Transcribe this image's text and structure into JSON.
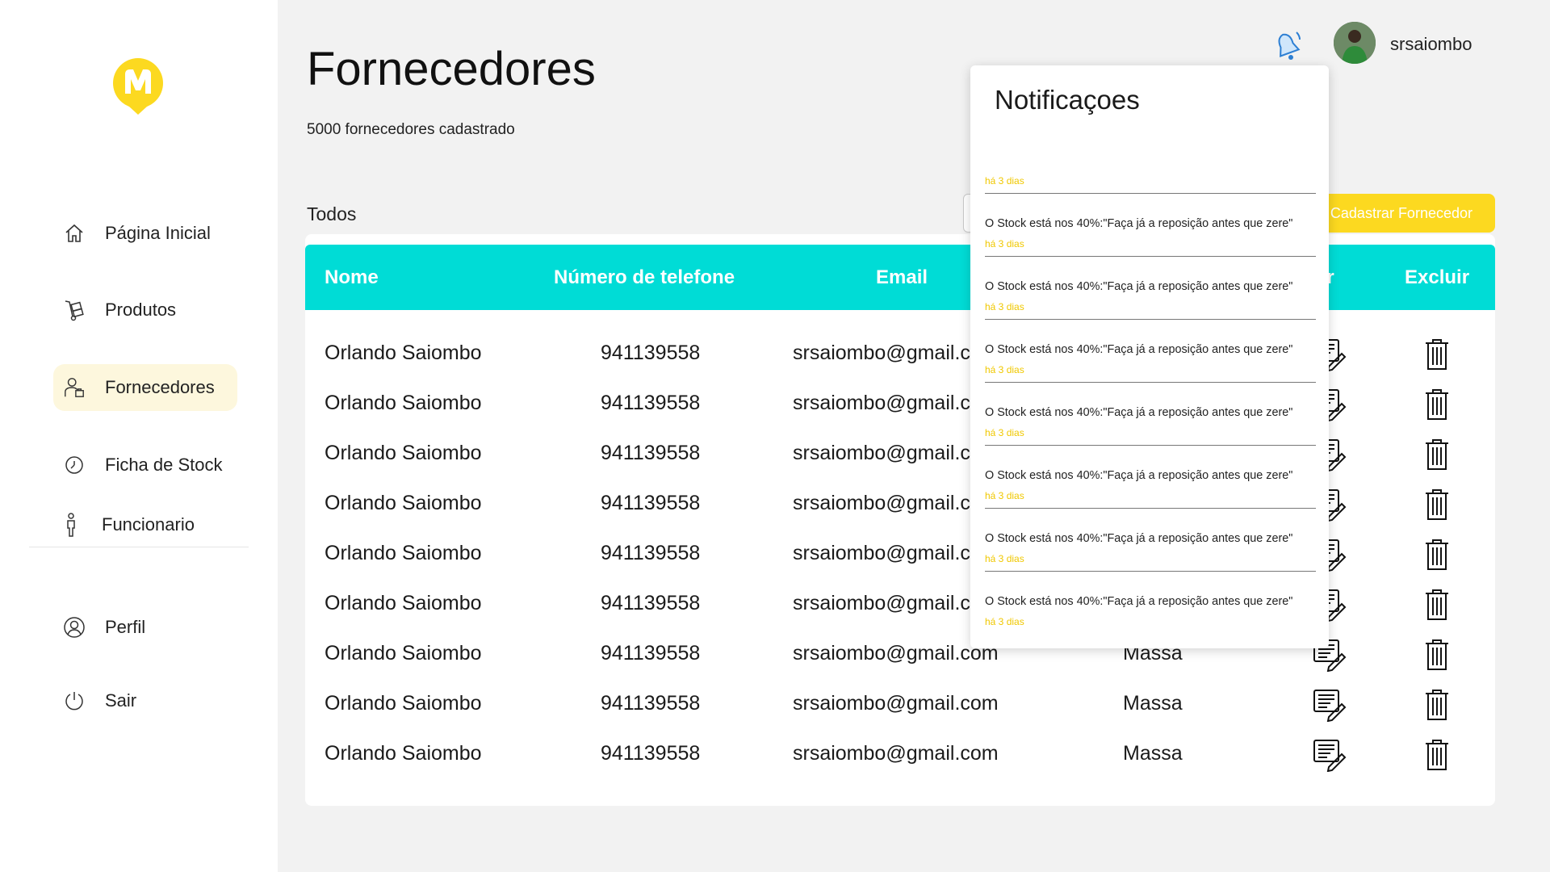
{
  "sidebar": {
    "items": [
      {
        "label": "Página Inicial",
        "icon": "home-icon"
      },
      {
        "label": "Produtos",
        "icon": "hand-truck-icon"
      },
      {
        "label": "Fornecedores",
        "icon": "supplier-icon",
        "active": true
      },
      {
        "label": "Ficha de Stock",
        "icon": "clock-icon"
      },
      {
        "label": "Funcionario",
        "icon": "person-icon"
      }
    ],
    "bottom_items": [
      {
        "label": "Perfil",
        "icon": "user-circle-icon"
      },
      {
        "label": "Sair",
        "icon": "power-icon"
      }
    ]
  },
  "header": {
    "title": "Fornecedores",
    "subtitle": "5000 fornecedores cadastrado",
    "username": "srsaiombo"
  },
  "toolbar": {
    "filter_label": "Todos",
    "add_label": "Cadastrar  Fornecedor"
  },
  "table": {
    "columns": [
      "Nome",
      "Número  de  telefone",
      "Email",
      "tar",
      "Excluir"
    ],
    "rows": [
      {
        "name": "Orlando Saiombo",
        "phone": "941139558",
        "email": "srsaiombo@gmail.c",
        "address": ""
      },
      {
        "name": "Orlando Saiombo",
        "phone": "941139558",
        "email": "srsaiombo@gmail.c",
        "address": ""
      },
      {
        "name": "Orlando Saiombo",
        "phone": "941139558",
        "email": "srsaiombo@gmail.c",
        "address": ""
      },
      {
        "name": "Orlando Saiombo",
        "phone": "941139558",
        "email": "srsaiombo@gmail.c",
        "address": ""
      },
      {
        "name": "Orlando Saiombo",
        "phone": "941139558",
        "email": "srsaiombo@gmail.c",
        "address": ""
      },
      {
        "name": "Orlando Saiombo",
        "phone": "941139558",
        "email": "srsaiombo@gmail.c",
        "address": ""
      },
      {
        "name": "Orlando Saiombo",
        "phone": "941139558",
        "email": "srsaiombo@gmail.com",
        "address": "Massa"
      },
      {
        "name": "Orlando Saiombo",
        "phone": "941139558",
        "email": "srsaiombo@gmail.com",
        "address": "Massa"
      },
      {
        "name": "Orlando Saiombo",
        "phone": "941139558",
        "email": "srsaiombo@gmail.com",
        "address": "Massa"
      }
    ]
  },
  "notifications": {
    "title": "Notificaçoes",
    "items": [
      {
        "message": "",
        "time": "há 3 dias"
      },
      {
        "message": "O Stock está nos 40%:\"Faça já a reposição antes que zere\"",
        "time": "há 3 dias"
      },
      {
        "message": "O Stock está nos 40%:\"Faça já a reposição antes que zere\"",
        "time": "há 3 dias"
      },
      {
        "message": "O Stock está nos 40%:\"Faça já a reposição antes que zere\"",
        "time": "há 3 dias"
      },
      {
        "message": "O Stock está nos 40%:\"Faça já a reposição antes que zere\"",
        "time": "há 3 dias"
      },
      {
        "message": "O Stock está nos 40%:\"Faça já a reposição antes que zere\"",
        "time": "há 3 dias"
      },
      {
        "message": "O Stock está nos 40%:\"Faça já a reposição antes que zere\"",
        "time": "há 3 dias"
      },
      {
        "message": "O Stock está nos 40%:\"Faça já a reposição antes que zere\"",
        "time": "há 3 dias"
      }
    ]
  },
  "colors": {
    "brand_yellow": "#fcd920",
    "header_teal": "#00dcd6",
    "active_bg": "#fdf7dd"
  }
}
